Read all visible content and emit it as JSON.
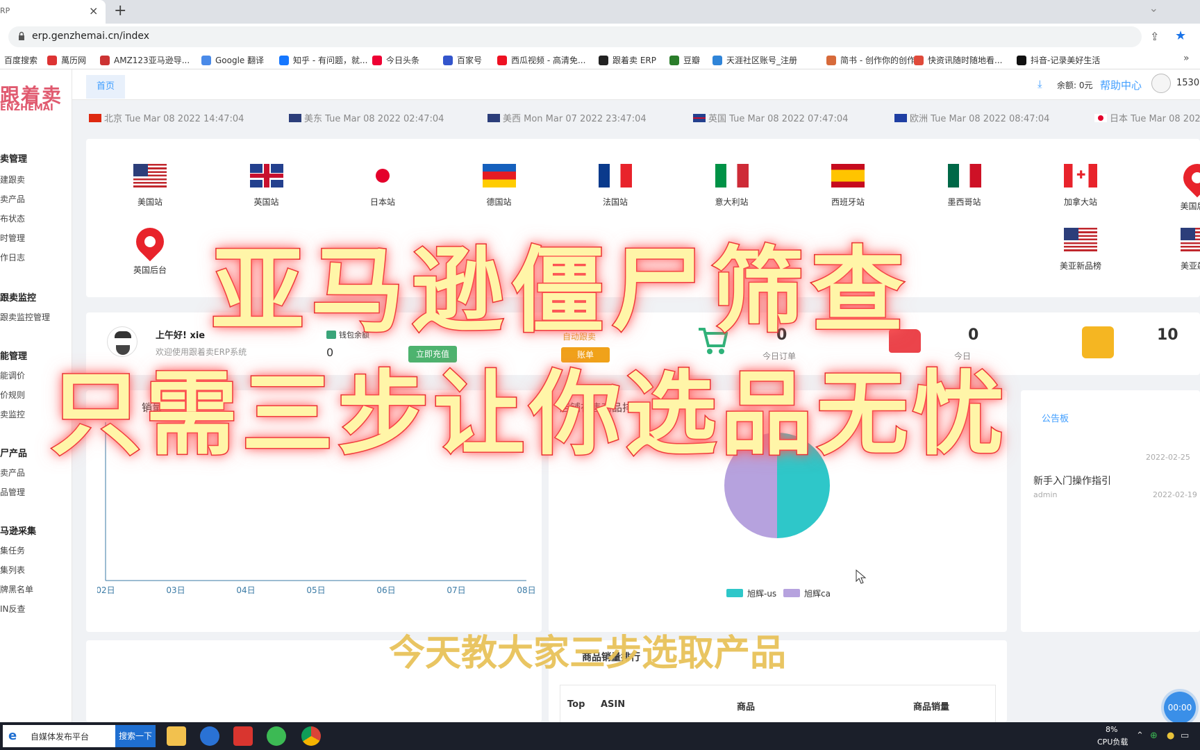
{
  "browser": {
    "tab_title": "RP",
    "tab_close": "×",
    "new_tab": "+",
    "url": "erp.genzhemai.cn/index",
    "bookmarks": [
      "百度搜索",
      "萬历网",
      "AMZ123亚马逊导...",
      "Google 翻译",
      "知乎 - 有问题，就...",
      "今日头条",
      "百家号",
      "西瓜视频 - 高清免...",
      "跟着卖 ERP",
      "豆瓣",
      "天涯社区账号_注册",
      "简书 - 创作你的创作",
      "快资讯随时随地看...",
      "抖音-记录美好生活"
    ],
    "bookmark_more": "»"
  },
  "sidebar": {
    "logo_cn": "跟着卖",
    "logo_en": "ENZHEMAI",
    "groups": [
      {
        "title": "卖管理",
        "items": [
          "建跟卖",
          "卖产品",
          "布状态",
          "时管理",
          "作日志"
        ]
      },
      {
        "title": "跟卖监控",
        "items": [
          "跟卖监控管理"
        ]
      },
      {
        "title": "能管理",
        "items": [
          "能调价",
          "价规则",
          "卖监控"
        ]
      },
      {
        "title": "尸产品",
        "items": [
          "卖产品",
          "品管理"
        ]
      },
      {
        "title": "马逊采集",
        "items": [
          "集任务",
          "集列表",
          "牌黑名单",
          "IN反查"
        ]
      }
    ]
  },
  "header": {
    "home_tab": "首页",
    "balance": "余额: 0元",
    "help": "帮助中心",
    "user_id": "1530"
  },
  "clocks": [
    {
      "label": "北京 Tue Mar 08 2022 14:47:04",
      "flag": "cn"
    },
    {
      "label": "美东 Tue Mar 08 2022 02:47:04",
      "flag": "us"
    },
    {
      "label": "美西 Mon Mar 07 2022 23:47:04",
      "flag": "us"
    },
    {
      "label": "英国 Tue Mar 08 2022 07:47:04",
      "flag": "uk"
    },
    {
      "label": "欧洲 Tue Mar 08 2022 08:47:04",
      "flag": "eu"
    },
    {
      "label": "日本 Tue Mar 08 2022",
      "flag": "jp"
    }
  ],
  "stations_row1": [
    {
      "name": "美国站",
      "flag": "us"
    },
    {
      "name": "英国站",
      "flag": "uk"
    },
    {
      "name": "日本站",
      "flag": "jp"
    },
    {
      "name": "德国站",
      "flag": "de"
    },
    {
      "name": "法国站",
      "flag": "fr"
    },
    {
      "name": "意大利站",
      "flag": "it"
    },
    {
      "name": "西班牙站",
      "flag": "es"
    },
    {
      "name": "墨西哥站",
      "flag": "mx"
    },
    {
      "name": "加拿大站",
      "flag": "ca"
    },
    {
      "name": "美国后台",
      "flag": "pin"
    }
  ],
  "stations_row2": [
    {
      "name": "英国后台",
      "flag": "pin"
    },
    {
      "name": "美亚新品榜",
      "flag": "us"
    },
    {
      "name": "美亚飙升",
      "flag": "us"
    }
  ],
  "dashboard": {
    "greeting": "上午好!  xie",
    "welcome": "欢迎使用跟着卖ERP系统",
    "wallet_label": "钱包余额",
    "wallet_value": "0",
    "recharge": "立即充值",
    "order_label": "自动跟卖",
    "order_button": "账单",
    "stat1_value": "0",
    "stat1_label": "今日订单",
    "stat2_value": "0",
    "stat2_label": "今日",
    "stat3_value": "10"
  },
  "sales_chart": {
    "title": "销量"
  },
  "pie_panel": {
    "title": "店铺在售商品排行"
  },
  "chart_data": [
    {
      "type": "line",
      "title": "销量",
      "categories": [
        "02日",
        "03日",
        "04日",
        "05日",
        "06日",
        "07日",
        "08日"
      ],
      "series": [
        {
          "values": [
            0,
            0,
            0,
            0,
            0,
            0,
            0
          ]
        }
      ]
    },
    {
      "type": "pie",
      "title": "店铺在售商品排行",
      "categories": [
        "旭辉-us",
        "旭辉ca"
      ],
      "values": [
        50,
        50
      ],
      "colors": [
        "#2ec7c9",
        "#b6a2de"
      ]
    }
  ],
  "notices": {
    "title": "公告板",
    "items": [
      {
        "text": "新手入门操作指引",
        "author": "admin",
        "date": "2022-02-19"
      }
    ],
    "date_top": "2022-02-25"
  },
  "ranking": {
    "title": "商品销量排行",
    "columns": [
      "Top",
      "ASIN",
      "商品",
      "商品销量"
    ]
  },
  "overlay": {
    "line1": "亚马逊僵尸筛查",
    "line2": "只需三步让你选品无忧",
    "subtitle": "今天教大家三步选取产品"
  },
  "timer": "00:00",
  "taskbar": {
    "search_text": "自媒体发布平台",
    "search_button": "搜索一下",
    "cpu_pct": "8%",
    "cpu_label": "CPU负载"
  }
}
